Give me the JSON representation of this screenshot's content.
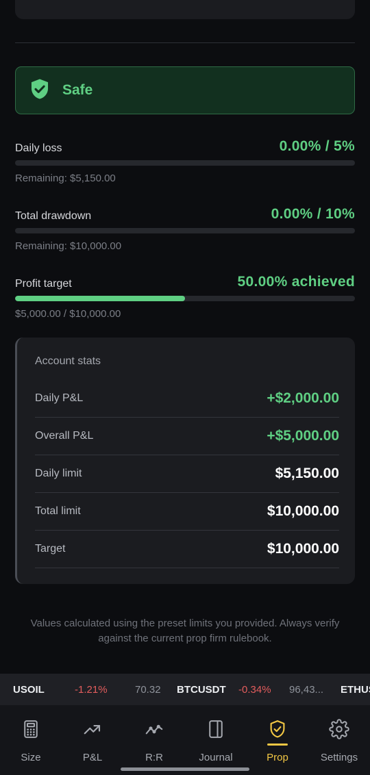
{
  "status": {
    "label": "Safe",
    "color": "#5fcf83"
  },
  "metrics": {
    "daily_loss": {
      "label": "Daily loss",
      "value": "0.00% / 5%",
      "sub": "Remaining: $5,150.00",
      "progress": 0
    },
    "total_drawdown": {
      "label": "Total drawdown",
      "value": "0.00% / 10%",
      "sub": "Remaining: $10,000.00",
      "progress": 0
    },
    "profit_target": {
      "label": "Profit target",
      "value": "50.00% achieved",
      "sub": "$5,000.00 / $10,000.00",
      "progress": 0.5
    }
  },
  "account_stats": {
    "title": "Account stats",
    "rows": [
      {
        "label": "Daily P&L",
        "value": "+$2,000.00"
      },
      {
        "label": "Overall P&L",
        "value": "+$5,000.00"
      },
      {
        "label": "Daily limit",
        "value": "$5,150.00"
      },
      {
        "label": "Total limit",
        "value": "$10,000.00"
      },
      {
        "label": "Target",
        "value": "$10,000.00"
      }
    ]
  },
  "note": "Values calculated using the preset limits you provided. Always verify against the current prop firm rulebook.",
  "ticker": [
    {
      "symbol": "USOIL",
      "change": "-1.21%",
      "price": "70.32"
    },
    {
      "symbol": "BTCUSDT",
      "change": "-0.34%",
      "price": "96,43..."
    },
    {
      "symbol": "ETHUS"
    }
  ],
  "nav": [
    {
      "label": "Size",
      "icon": "calculator-icon"
    },
    {
      "label": "P&L",
      "icon": "trend-up-icon"
    },
    {
      "label": "R:R",
      "icon": "line-chart-icon"
    },
    {
      "label": "Journal",
      "icon": "journal-icon"
    },
    {
      "label": "Prop",
      "icon": "shield-check-icon",
      "active": true
    },
    {
      "label": "Settings",
      "icon": "gear-icon"
    }
  ],
  "colors": {
    "accent": "#f2c744",
    "positive": "#5fcf83",
    "negative": "#e35d5d"
  }
}
